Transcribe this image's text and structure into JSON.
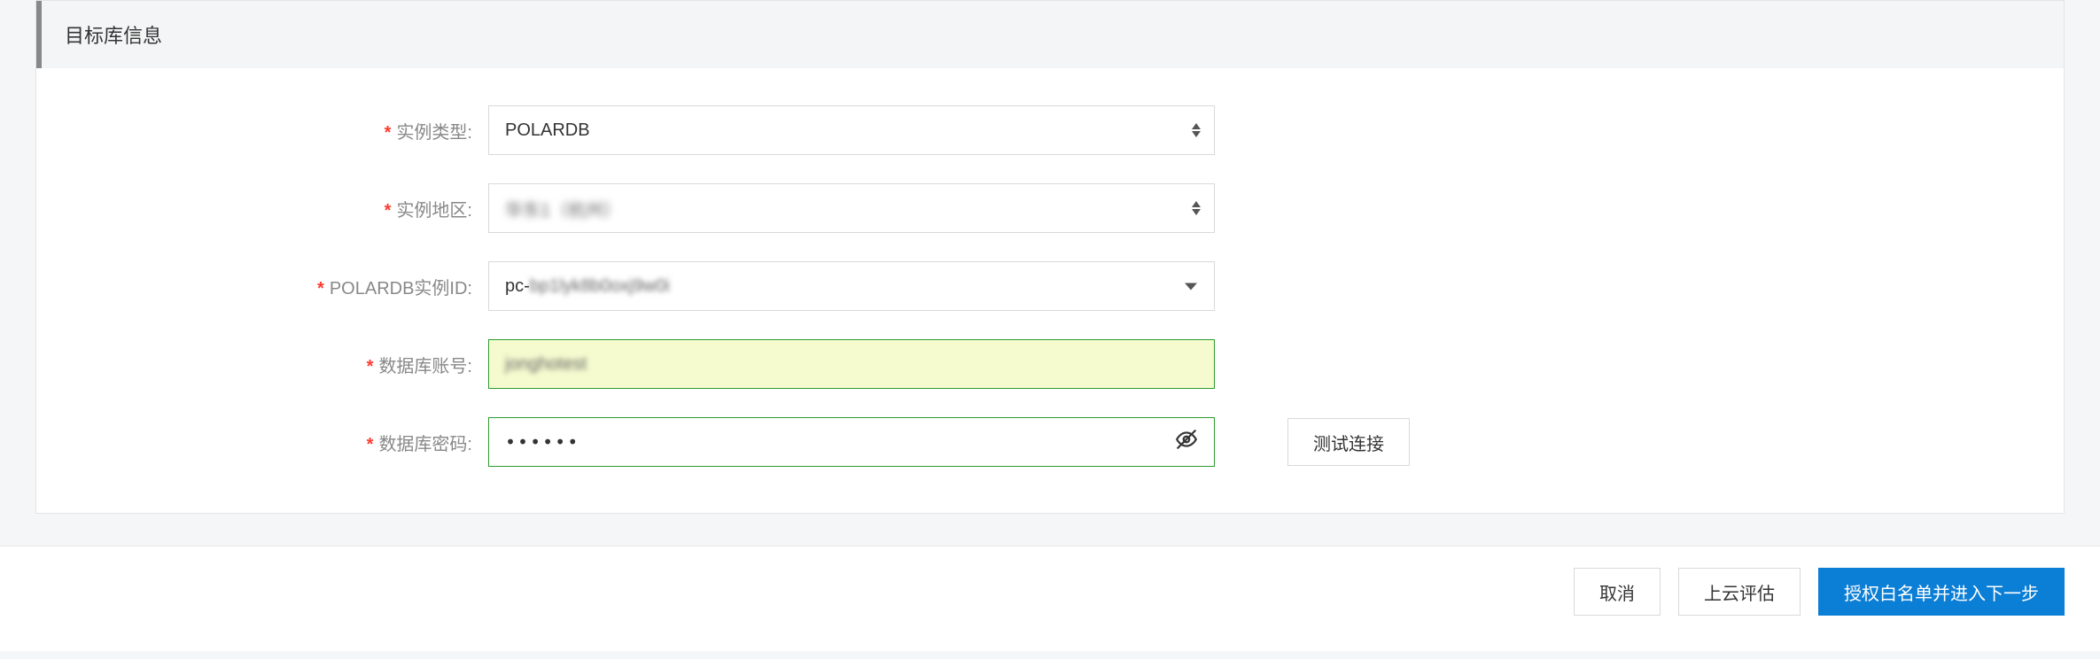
{
  "panel": {
    "title": "目标库信息"
  },
  "form": {
    "instanceType": {
      "label": "实例类型:",
      "value": "POLARDB"
    },
    "instanceRegion": {
      "label": "实例地区:",
      "value": "华东1（杭州）"
    },
    "polardbInstanceId": {
      "label": "POLARDB实例ID:",
      "prefix": "pc-",
      "masked": "bp1lyk8b0oxj9w0i"
    },
    "dbAccount": {
      "label": "数据库账号:",
      "value": "jonghotest"
    },
    "dbPassword": {
      "label": "数据库密码:",
      "value": "••••••"
    },
    "testConnection": "测试连接"
  },
  "footer": {
    "cancel": "取消",
    "cloudAssess": "上云评估",
    "authNext": "授权白名单并进入下一步"
  }
}
